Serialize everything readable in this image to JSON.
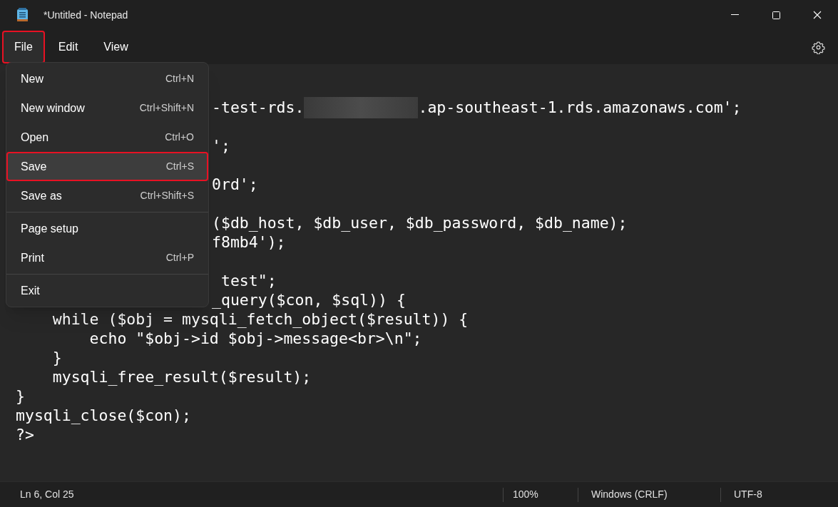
{
  "window": {
    "title": "*Untitled - Notepad"
  },
  "menu_bar": [
    {
      "label": "File",
      "selected": true,
      "highlighted": true
    },
    {
      "label": "Edit",
      "selected": false,
      "highlighted": false
    },
    {
      "label": "View",
      "selected": false,
      "highlighted": false
    }
  ],
  "file_menu": [
    {
      "kind": "item",
      "label": "New",
      "shortcut": "Ctrl+N",
      "highlighted": false,
      "selected": false
    },
    {
      "kind": "item",
      "label": "New window",
      "shortcut": "Ctrl+Shift+N",
      "highlighted": false,
      "selected": false
    },
    {
      "kind": "item",
      "label": "Open",
      "shortcut": "Ctrl+O",
      "highlighted": false,
      "selected": false
    },
    {
      "kind": "item",
      "label": "Save",
      "shortcut": "Ctrl+S",
      "highlighted": true,
      "selected": true
    },
    {
      "kind": "item",
      "label": "Save as",
      "shortcut": "Ctrl+Shift+S",
      "highlighted": false,
      "selected": false
    },
    {
      "kind": "separator"
    },
    {
      "kind": "item",
      "label": "Page setup",
      "highlighted": false,
      "selected": false
    },
    {
      "kind": "item",
      "label": "Print",
      "shortcut": "Ctrl+P",
      "highlighted": false,
      "selected": false
    },
    {
      "kind": "separator"
    },
    {
      "kind": "item",
      "label": "Exit",
      "highlighted": false,
      "selected": false
    }
  ],
  "editor_lines": [
    {
      "kind": "blank"
    },
    {
      "kind": "covered",
      "text": "-test-rds.",
      "redacted": true,
      "text_after": ".ap-southeast-1.rds.amazonaws.com';"
    },
    {
      "kind": "blank"
    },
    {
      "kind": "covered",
      "text": "';"
    },
    {
      "kind": "blank"
    },
    {
      "kind": "covered",
      "text": "0rd';"
    },
    {
      "kind": "blank"
    },
    {
      "kind": "covered",
      "text": "($db_host, $db_user, $db_password, $db_name);"
    },
    {
      "kind": "covered",
      "text": "f8mb4');"
    },
    {
      "kind": "blank"
    },
    {
      "kind": "covered",
      "text": " test\";"
    },
    {
      "kind": "covered",
      "text": "_query($con, $sql)) {"
    },
    {
      "kind": "code",
      "text": "    while ($obj = mysqli_fetch_object($result)) {"
    },
    {
      "kind": "code",
      "text": "        echo \"$obj->id $obj->message<br>\\n\";"
    },
    {
      "kind": "code",
      "text": "    }"
    },
    {
      "kind": "code",
      "text": "    mysqli_free_result($result);"
    },
    {
      "kind": "code",
      "text": "}"
    },
    {
      "kind": "code",
      "text": "mysqli_close($con);"
    },
    {
      "kind": "code",
      "text": "?>"
    }
  ],
  "status_bar": {
    "position": "Ln 6, Col 25",
    "zoom": "100%",
    "line_ending": "Windows (CRLF)",
    "encoding": "UTF-8"
  }
}
